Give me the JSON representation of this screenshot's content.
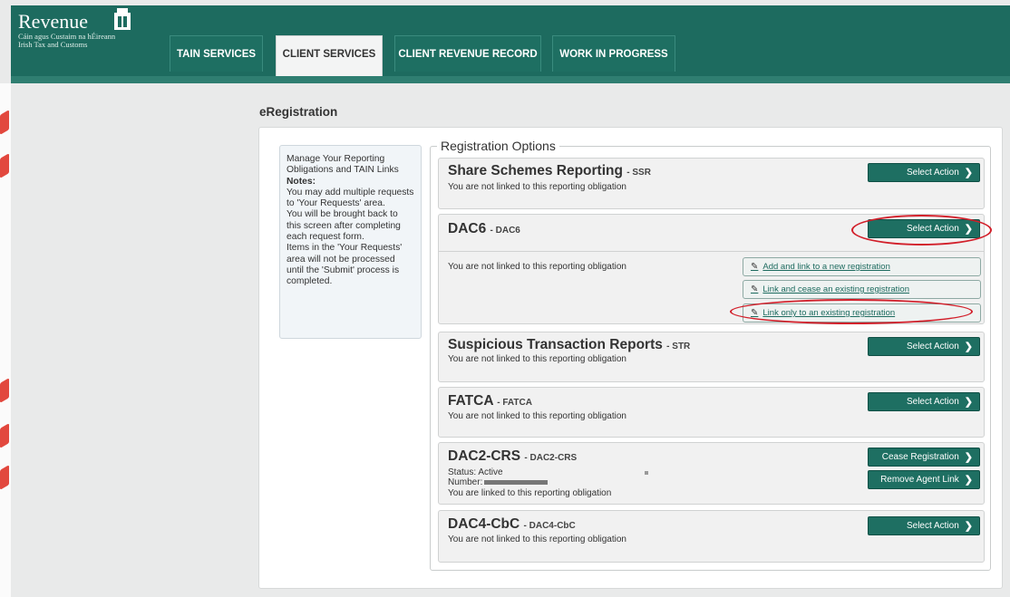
{
  "brand": {
    "name": "Revenue",
    "subtitle_line1": "Cáin agus Custaim na hÉireann",
    "subtitle_line2": "Irish Tax and Customs"
  },
  "tabs": [
    {
      "label": "TAIN SERVICES",
      "active": false
    },
    {
      "label": "CLIENT SERVICES",
      "active": true
    },
    {
      "label": "CLIENT REVENUE RECORD",
      "active": false
    },
    {
      "label": "WORK IN PROGRESS",
      "active": false
    }
  ],
  "page": {
    "title": "eRegistration"
  },
  "notes": {
    "intro": "Manage Your Reporting Obligations and TAIN Links",
    "heading": "Notes:",
    "line1": "You may add multiple requests to 'Your Requests' area.",
    "line2": "You will be brought back to this screen after completing each request form.",
    "line3": "Items in the 'Your Requests' area will not be processed until the 'Submit' process is completed."
  },
  "options": {
    "legend": "Registration Options",
    "items": [
      {
        "title": "Share Schemes Reporting",
        "code": "- SSR",
        "status": "You are not linked to this reporting obligation",
        "button": "Select Action"
      },
      {
        "title": "DAC6",
        "code": "- DAC6",
        "status": "You are not linked to this reporting obligation",
        "button": "Select Action",
        "links": [
          "Add and link to a new registration",
          "Link and cease an existing registration",
          "Link only to an existing registration"
        ]
      },
      {
        "title": "Suspicious Transaction Reports",
        "code": "- STR",
        "status": "You are not linked to this reporting obligation",
        "button": "Select Action"
      },
      {
        "title": "FATCA",
        "code": "- FATCA",
        "status": "You are not linked to this reporting obligation",
        "button": "Select Action"
      },
      {
        "title": "DAC2-CRS",
        "code": "- DAC2-CRS",
        "status_line": "Status: Active",
        "number_label": "Number:",
        "status": "You are linked to this reporting obligation",
        "button1": "Cease Registration",
        "button2": "Remove Agent Link"
      },
      {
        "title": "DAC4-CbC",
        "code": "- DAC4-CbC",
        "status": "You are not linked to this reporting obligation",
        "button": "Select Action"
      }
    ]
  },
  "colors": {
    "header": "#1d6b5f",
    "button": "#1e6f62",
    "annotation": "#d21f2a"
  }
}
